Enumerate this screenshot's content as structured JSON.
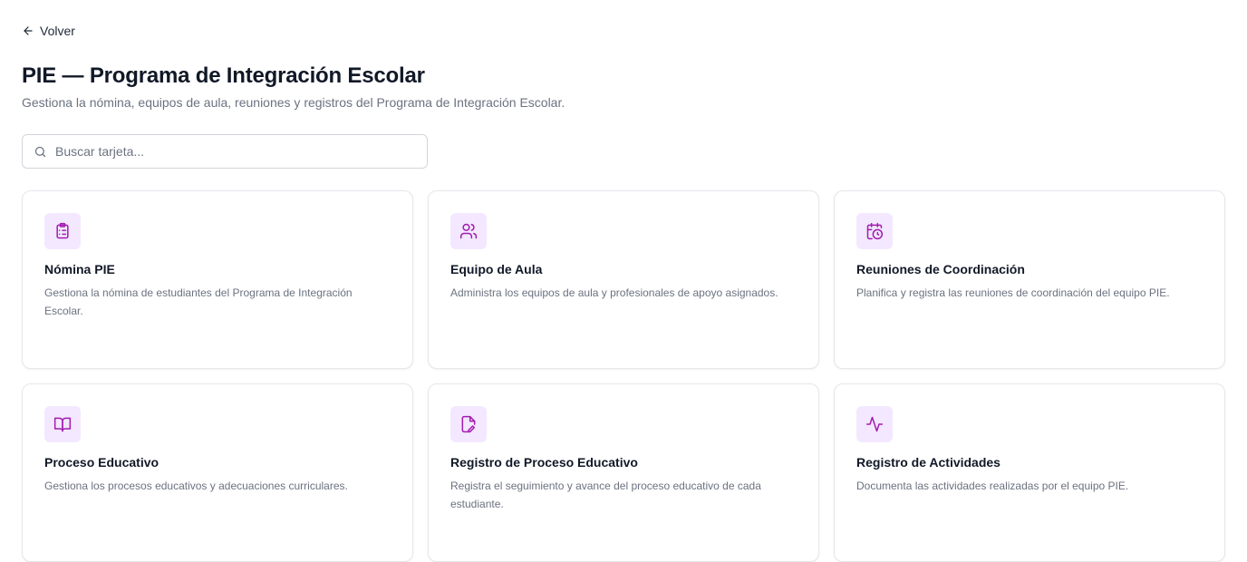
{
  "back": {
    "label": "Volver",
    "icon": "arrow-left-icon"
  },
  "header": {
    "title": "PIE — Programa de Integración Escolar",
    "subtitle": "Gestiona la nómina, equipos de aula, reuniones y registros del Programa de Integración Escolar."
  },
  "search": {
    "placeholder": "Buscar tarjeta...",
    "value": ""
  },
  "accent": {
    "icon_color": "#a21caf",
    "icon_bg": "#f3e8ff"
  },
  "cards": [
    {
      "title": "Nómina PIE",
      "description": "Gestiona la nómina de estudiantes del Programa de Integración Escolar.",
      "icon": "clipboard-list-icon"
    },
    {
      "title": "Equipo de Aula",
      "description": "Administra los equipos de aula y profesionales de apoyo asignados.",
      "icon": "users-icon"
    },
    {
      "title": "Reuniones de Coordinación",
      "description": "Planifica y registra las reuniones de coordinación del equipo PIE.",
      "icon": "calendar-clock-icon"
    },
    {
      "title": "Proceso Educativo",
      "description": "Gestiona los procesos educativos y adecuaciones curriculares.",
      "icon": "book-open-icon"
    },
    {
      "title": "Registro de Proceso Educativo",
      "description": "Registra el seguimiento y avance del proceso educativo de cada estudiante.",
      "icon": "file-pen-icon"
    },
    {
      "title": "Registro de Actividades",
      "description": "Documenta las actividades realizadas por el equipo PIE.",
      "icon": "activity-icon"
    }
  ]
}
